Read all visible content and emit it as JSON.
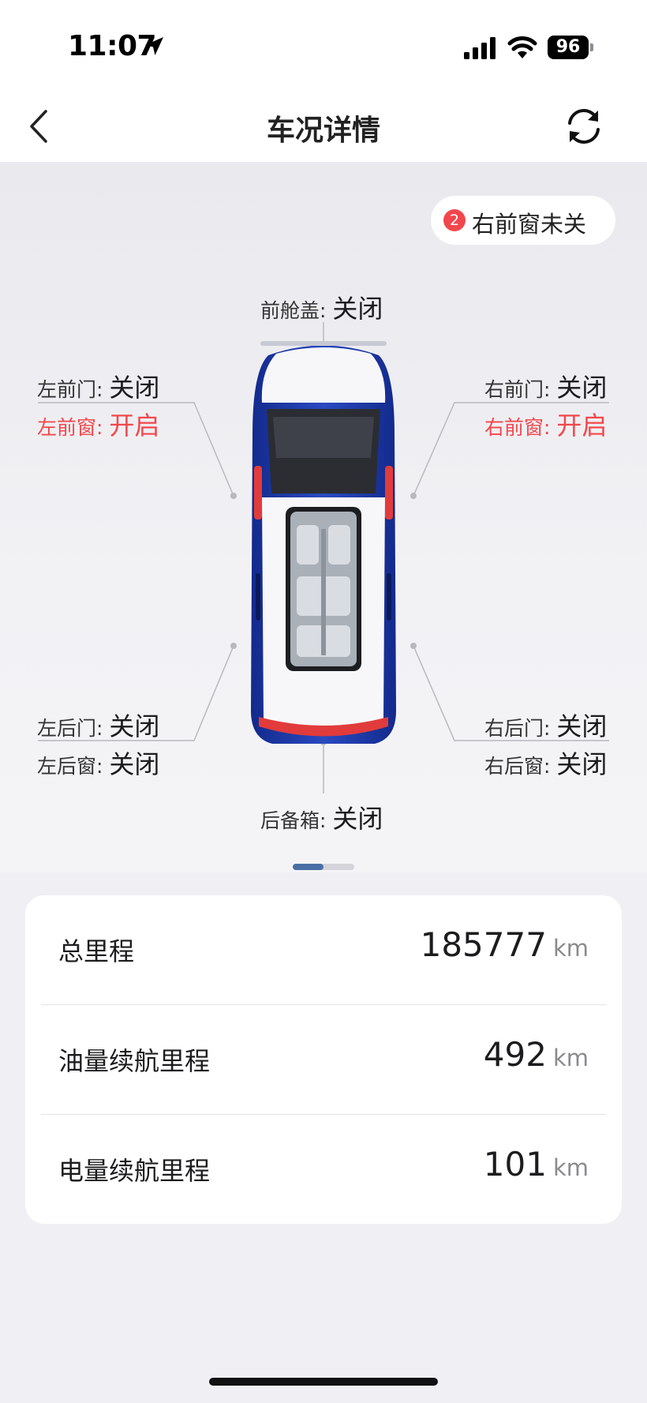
{
  "status_bar": {
    "time": "11:07",
    "battery": "96"
  },
  "nav": {
    "title": "车况详情"
  },
  "alert": {
    "count": "2",
    "text": "右前窗未关"
  },
  "vehicle": {
    "hood": {
      "key": "前舱盖: ",
      "value": "关闭"
    },
    "left_front_door": {
      "key": "左前门: ",
      "value": "关闭"
    },
    "left_front_window": {
      "key": "左前窗: ",
      "value": "开启"
    },
    "right_front_door": {
      "key": "右前门: ",
      "value": "关闭"
    },
    "right_front_window": {
      "key": "右前窗: ",
      "value": "开启"
    },
    "left_rear_door": {
      "key": "左后门: ",
      "value": "关闭"
    },
    "left_rear_window": {
      "key": "左后窗: ",
      "value": "关闭"
    },
    "right_rear_door": {
      "key": "右后门: ",
      "value": "关闭"
    },
    "right_rear_window": {
      "key": "右后窗: ",
      "value": "关闭"
    },
    "trunk": {
      "key": "后备箱: ",
      "value": "关闭"
    }
  },
  "pager": {
    "pages": 2,
    "active": 1
  },
  "mileage": {
    "rows": [
      {
        "label": "总里程",
        "value": "185777",
        "unit": "km"
      },
      {
        "label": "油量续航里程",
        "value": "492",
        "unit": "km"
      },
      {
        "label": "电量续航里程",
        "value": "101",
        "unit": "km"
      }
    ]
  },
  "colors": {
    "alert_red": "#f2474c",
    "car_blue": "#1f3aa8",
    "accent": "#4a6fa5"
  }
}
